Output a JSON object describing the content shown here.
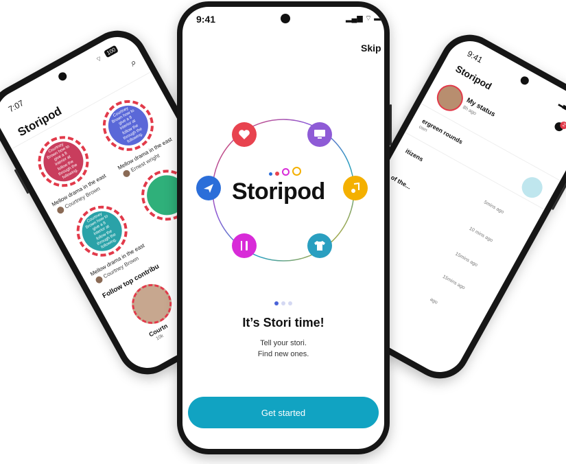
{
  "center": {
    "status_time": "9:41",
    "skip_label": "Skip",
    "logo_text": "Storipod",
    "headline": "It’s Stori time!",
    "subtitle_line1": "Tell your stori.",
    "subtitle_line2": "Find new ones.",
    "cta_label": "Get started",
    "icons": [
      "heart-icon",
      "monitor-icon",
      "music-icon",
      "tshirt-icon",
      "utensils-icon",
      "plane-icon"
    ],
    "colors": {
      "heart": "#e8434f",
      "monitor": "#8e5bd6",
      "music": "#f4b000",
      "tshirt": "#2a9fc0",
      "utensils": "#d82bd8",
      "plane": "#2b6ed9",
      "cta": "#11a3c2"
    }
  },
  "left": {
    "status_time": "7:07",
    "battery": "100",
    "logo_text": "Storipod",
    "story_text": "Courtney Brown how to give a 8 interior at follow the through the following.",
    "cards": [
      {
        "title": "Mellow drama in the east",
        "author": "Courtney Brown"
      },
      {
        "title": "Mellow drama in the east",
        "author": "Ernest wright"
      },
      {
        "title": "Mellow drama in the east",
        "author": "Courtney Brown"
      }
    ],
    "section_title": "Follow top contribu",
    "contributor": "Courtn",
    "contributor_sub": "10k"
  },
  "right": {
    "status_time": "9:41",
    "logo_text": "Storipod",
    "badge_count": "2",
    "my_status": "My status",
    "my_status_time": "8h ago",
    "rows": [
      {
        "title": "ergreen rounds",
        "sub": "own"
      },
      {
        "title": "itizens",
        "time": "5mins ago"
      },
      {
        "title": "of the...",
        "time": "10 mins ago"
      },
      {
        "time": "15mins ago"
      },
      {
        "time": "15mins ago"
      },
      {
        "time": "ago"
      }
    ]
  }
}
